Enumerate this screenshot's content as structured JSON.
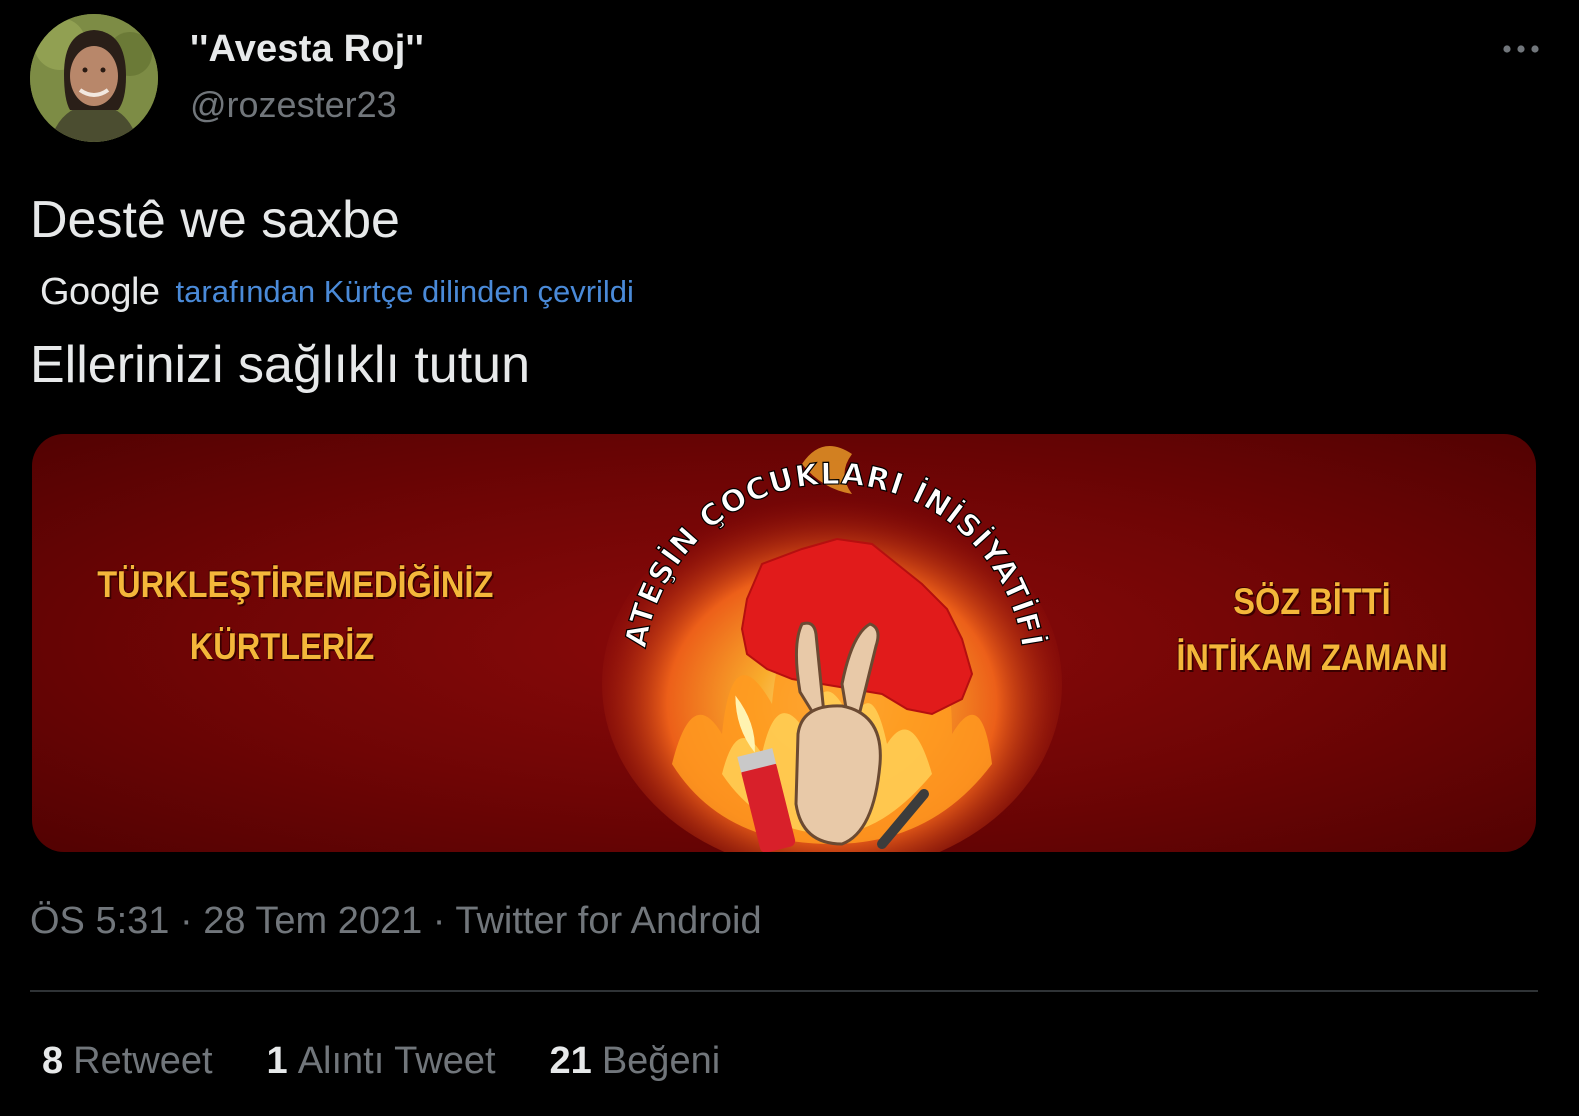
{
  "author": {
    "display_name": "''Avesta Roj''",
    "handle": "@rozester23",
    "avatar_icon": "profile-photo"
  },
  "tweet": {
    "text": "Destê we saxbe",
    "translation_provider": "Google",
    "translation_note": "tarafından Kürtçe dilinden çevrildi",
    "translated_text": "Ellerinizi sağlıklı tutun"
  },
  "media": {
    "left_lines": [
      "TÜRKLEŞTİREMEDİĞİNİZ",
      "KÜRTLERİZ"
    ],
    "right_lines": [
      "SÖZ BİTTİ",
      "İNTİKAM ZAMANI"
    ],
    "arc_text": "ATEŞİN ÇOCUKLARI İNİSİYATİFİ",
    "background_color": "#6f0505",
    "text_color": "#f4b73a"
  },
  "meta": {
    "time": "ÖS 5:31",
    "separator": " · ",
    "date": "28 Tem 2021",
    "source": "Twitter for Android"
  },
  "stats": [
    {
      "count": "8",
      "label": "Retweet"
    },
    {
      "count": "1",
      "label": "Alıntı Tweet"
    },
    {
      "count": "21",
      "label": "Beğeni"
    }
  ],
  "colors": {
    "background": "#000000",
    "text_primary": "#e7e9ea",
    "text_secondary": "#71767b",
    "link": "#4a8ad8",
    "divider": "#2f3336"
  }
}
